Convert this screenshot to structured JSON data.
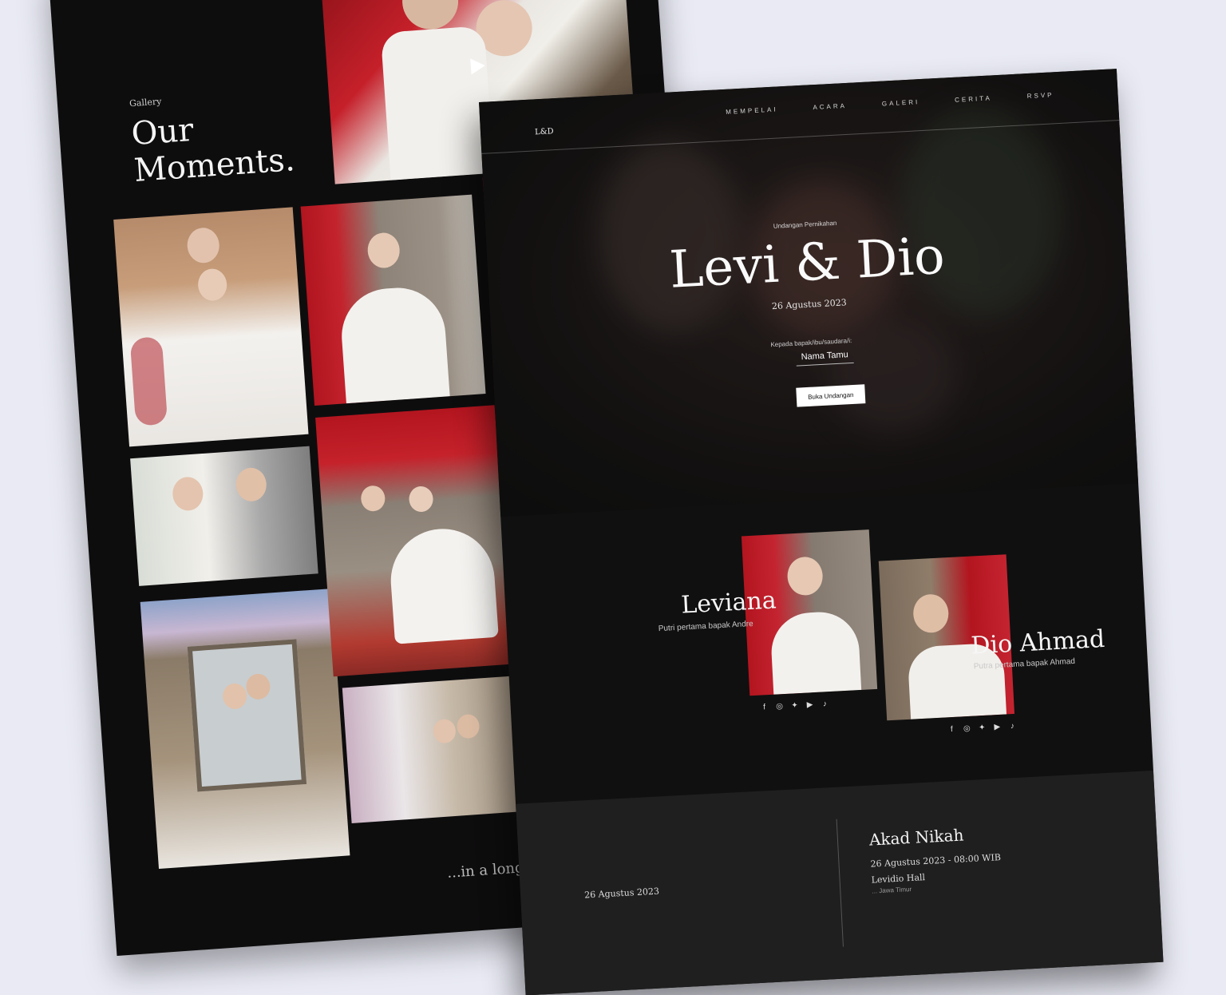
{
  "gallery": {
    "label": "Gallery",
    "title": "Our Moments.",
    "caption": "...in a long conversation"
  },
  "invitation": {
    "logo": "L&D",
    "menu": [
      "MEMPELAI",
      "ACARA",
      "GALERI",
      "CERITA",
      "RSVP"
    ],
    "kicker": "Undangan Pernikahan",
    "couple": "Levi & Dio",
    "date": "26 Agustus 2023",
    "to_label": "Kepada bapak/ibu/saudara/i:",
    "guest_name": "Nama Tamu",
    "open_button": "Buka Undangan"
  },
  "bride": {
    "name": "Leviana",
    "subtitle": "Putri pertama bapak Andre"
  },
  "groom": {
    "name": "Dio Ahmad",
    "subtitle": "Putra pertama bapak Ahmad"
  },
  "social_icons": [
    "facebook-icon",
    "instagram-icon",
    "twitter-icon",
    "youtube-icon",
    "tiktok-icon"
  ],
  "event": {
    "date": "26 Agustus 2023",
    "title": "Akad Nikah",
    "time": "26 Agustus 2023 - 08:00 WIB",
    "venue": "Levidio Hall",
    "address": "... Jawa Timur"
  },
  "colors": {
    "page_bg": "#e9eaf4",
    "panel_bg": "#0e0d0e",
    "accent_red": "#b3151f",
    "text_light": "#f4f4f4"
  }
}
